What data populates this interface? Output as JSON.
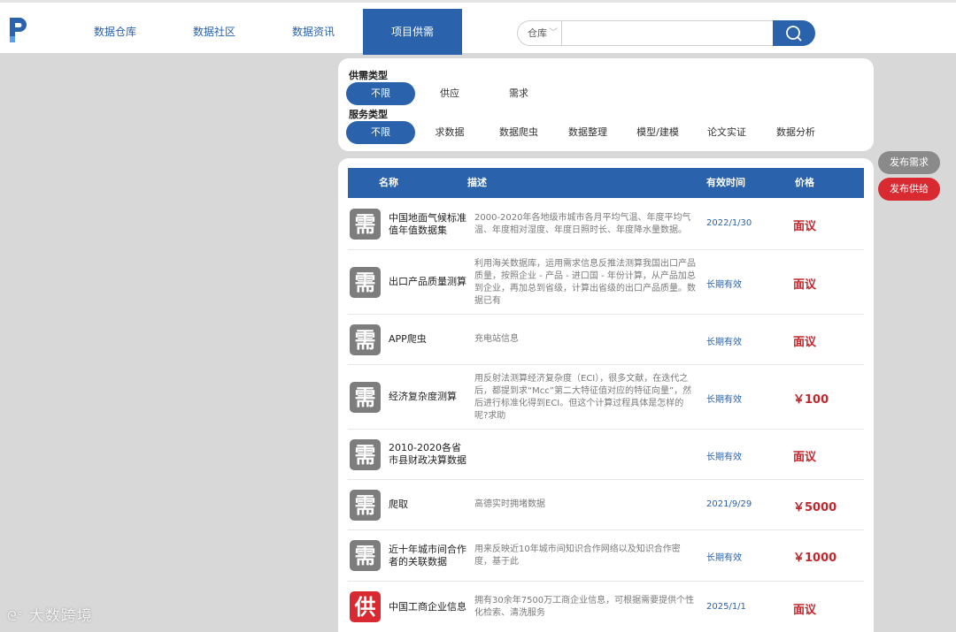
{
  "colors": {
    "brand": "#2a62ab",
    "price": "#c0282e",
    "demand_icon": "#7d7d7d",
    "supply_icon": "#d92a31"
  },
  "nav": {
    "logo_icon": "logo-p-icon",
    "items": [
      {
        "label": "数据仓库",
        "active": false
      },
      {
        "label": "数据社区",
        "active": false
      },
      {
        "label": "数据资讯",
        "active": false
      },
      {
        "label": "项目供需",
        "active": true
      }
    ]
  },
  "search": {
    "scope": "仓库",
    "value": "",
    "placeholder": "",
    "icon": "search-icon"
  },
  "filters": {
    "supply_demand_label": "供需类型",
    "supply_demand_options": [
      "不限",
      "供应",
      "需求"
    ],
    "service_label": "服务类型",
    "service_options": [
      "不限",
      "求数据",
      "数据爬虫",
      "数据整理",
      "模型/建模",
      "论文实证",
      "数据分析"
    ]
  },
  "table": {
    "headers": {
      "name": "名称",
      "desc": "描述",
      "time": "有效时间",
      "price": "价格"
    },
    "rows": [
      {
        "type": "需",
        "name": "中国地面气候标准值年值数据集",
        "desc": "2000-2020年各地级市城市各月平均气温、年度平均气温、年度相对湿度、年度日照时长、年度降水量数据。",
        "time": "2022/1/30",
        "price": "面议"
      },
      {
        "type": "需",
        "name": "出口产品质量测算",
        "desc": "利用海关数据库，运用需求信息反推法测算我国出口产品质量，按照企业 - 产品 - 进口国 - 年份计算，从产品加总到企业，再加总到省级，计算出省级的出口产品质量。数据已有",
        "time": "长期有效",
        "price": "面议"
      },
      {
        "type": "需",
        "name": "APP爬虫",
        "desc": "充电站信息",
        "time": "长期有效",
        "price": "面议"
      },
      {
        "type": "需",
        "name": "经济复杂度测算",
        "desc": "用反射法测算经济复杂度（ECI），很多文献，在迭代之后，都提到求“Mcc”第二大特征值对应的特征向量”，然后进行标准化得到ECI。但这个计算过程具体是怎样的呢?求助",
        "time": "长期有效",
        "price": "￥100"
      },
      {
        "type": "需",
        "name": "2010-2020各省市县财政决算数据",
        "desc": "",
        "time": "长期有效",
        "price": "面议"
      },
      {
        "type": "需",
        "name": "爬取",
        "desc": "高德实时拥堵数据",
        "time": "2021/9/29",
        "price": "￥5000"
      },
      {
        "type": "需",
        "name": "近十年城市间合作者的关联数据",
        "desc": "用来反映近10年城市间知识合作网络以及知识合作密度，基于此",
        "time": "长期有效",
        "price": "￥1000"
      },
      {
        "type": "供",
        "name": "中国工商企业信息",
        "desc": "拥有30余年7500万工商企业信息，可根据需要提供个性化检索、清洗服务",
        "time": "2025/1/1",
        "price": "面议"
      }
    ]
  },
  "actions": {
    "publish_demand": "发布需求",
    "publish_supply": "发布供给"
  },
  "watermark": "大数跨境"
}
